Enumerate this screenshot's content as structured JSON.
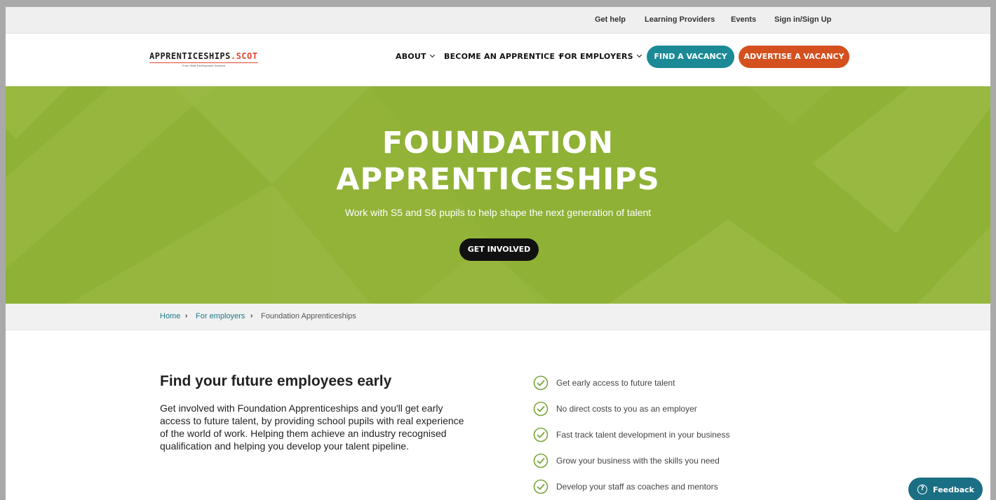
{
  "utility_nav": {
    "get_help": "Get help",
    "learning_providers": "Learning Providers",
    "events": "Events",
    "sign_in": "Sign in/Sign Up"
  },
  "logo": {
    "name_part1": "APPRENTICESHIPS",
    "name_part2": ".SCOT",
    "tagline": "From Skills Development Scotland"
  },
  "main_nav": {
    "about": "ABOUT",
    "become_apprentice": "BECOME AN APPRENTICE",
    "for_employers": "FOR EMPLOYERS",
    "find_vacancy": "FIND A VACANCY",
    "advertise_vacancy": "ADVERTISE A VACANCY"
  },
  "hero": {
    "title_line1": "FOUNDATION",
    "title_line2": "APPRENTICESHIPS",
    "subtitle": "Work with S5 and S6 pupils to help shape the next generation of talent",
    "cta": "GET INVOLVED"
  },
  "breadcrumb": {
    "home": "Home",
    "for_employers": "For employers",
    "current": "Foundation Apprenticeships"
  },
  "content": {
    "title": "Find your future employees early",
    "body": "Get involved with Foundation Apprenticeships and you'll get early access to future talent, by providing school pupils with real experience of the world of work. Helping them achieve an industry recognised qualification and helping you develop your talent pipeline."
  },
  "benefits": [
    "Get early access to future talent",
    "No direct costs to you as an employer",
    "Fast track talent development in your business",
    "Grow your business with the skills you need",
    "Develop your staff as coaches and mentors"
  ],
  "feedback": {
    "label": "Feedback",
    "icon_glyph": "?"
  },
  "colors": {
    "hero_green": "#8fb135",
    "teal": "#1b8a96",
    "orange": "#d4501f",
    "check_green": "#7aa63a"
  }
}
